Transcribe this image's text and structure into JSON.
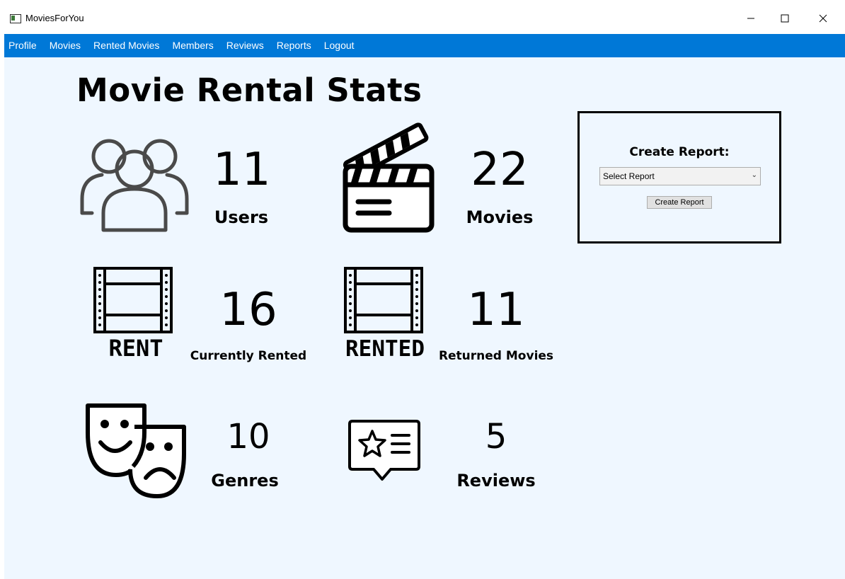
{
  "window": {
    "title": "MoviesForYou"
  },
  "menu": {
    "items": [
      "Profile",
      "Movies",
      "Rented Movies",
      "Members",
      "Reviews",
      "Reports",
      "Logout"
    ]
  },
  "page": {
    "title": "Movie Rental Stats"
  },
  "stats": {
    "users": {
      "value": "11",
      "label": "Users",
      "icon": "users-icon"
    },
    "movies": {
      "value": "22",
      "label": "Movies",
      "icon": "clapperboard-icon"
    },
    "currently_rented": {
      "value": "16",
      "label": "Currently Rented",
      "icon": "film-rent-icon",
      "icon_text": "RENT"
    },
    "returned": {
      "value": "11",
      "label": "Returned Movies",
      "icon": "film-rented-icon",
      "icon_text": "RENTED"
    },
    "genres": {
      "value": "10",
      "label": "Genres",
      "icon": "theater-masks-icon"
    },
    "reviews": {
      "value": "5",
      "label": "Reviews",
      "icon": "review-star-icon"
    }
  },
  "report": {
    "heading": "Create Report:",
    "select_value": "Select Report",
    "button_label": "Create Report"
  },
  "colors": {
    "menubar": "#0078d7",
    "content_bg": "#eff7ff",
    "titlebar_bg": "#ffffff"
  }
}
